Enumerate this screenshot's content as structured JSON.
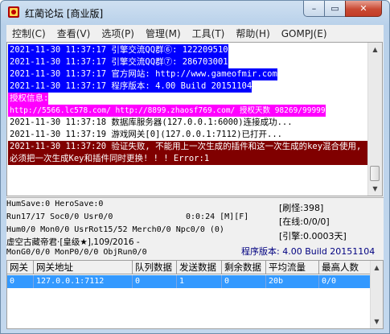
{
  "window": {
    "title": "红蔺论坛 [商业版]",
    "min_glyph": "–",
    "max_glyph": "▭",
    "close_glyph": "✕"
  },
  "menu": [
    "控制(C)",
    "查看(V)",
    "选项(P)",
    "管理(M)",
    "工具(T)",
    "帮助(H)",
    "GOMPJ(E)"
  ],
  "log": [
    {
      "style": "blue",
      "text": "2021-11-30 11:37:17 引擎交流QQ群⑥: 122209510"
    },
    {
      "style": "blue",
      "text": "2021-11-30 11:37:17 引擎交流QQ群⑦: 286703001"
    },
    {
      "style": "blue",
      "text": "2021-11-30 11:37:17 官方网站: http://www.gameofmir.com"
    },
    {
      "style": "blue",
      "text": "2021-11-30 11:37:17 程序版本: 4.00 Build 20151104"
    },
    {
      "style": "mag",
      "text": "授权信息:"
    },
    {
      "style": "mag2",
      "text": "http://5566.lc578.com/ http://8899.zhaosf769.com/ 授权天数 98269/99999"
    },
    {
      "style": "plain",
      "text": "2021-11-30 11:37:18 数据库服务器(127.0.0.1:6000)连接成功..."
    },
    {
      "style": "plain",
      "text": "2021-11-30 11:37:19 游戏网关[0](127.0.0.1:7112)已打开..."
    },
    {
      "style": "red",
      "text": "2021-11-30 11:37:20 验证失败, 不能用上一次生成的插件和这一次生成的key混合使用, 必须把一次生成Key和插件同时更换! ! !  Error:1"
    }
  ],
  "status": {
    "line1": "HumSave:0 HeroSave:0",
    "line2_left": "Run17/17 Soc0/0 Usr0/0",
    "time": "0:0:24 [M][F]",
    "line3": "Hum0/0 Mon0/0 UsrRot15/52 Merch0/0 Npc0/0 (0)",
    "line4": "虚空古藏帝君·[皇级★],109/2016 -",
    "line5": "MonG0/0/0 MonP0/0/0 ObjRun0/0",
    "refresh": "[刷怪:398]",
    "online": "[在线:0/0/0]",
    "engine": "[引擎:0.0003天]",
    "version": "程序版本: 4.00 Build 20151104"
  },
  "gateway_table": {
    "columns": [
      "网关",
      "网关地址",
      "队列数据",
      "发送数据",
      "剩余数据",
      "平均流量",
      "最高人数"
    ],
    "rows": [
      [
        "0",
        "127.0.0.1:7112",
        "0",
        "1",
        "0",
        "20b",
        "0/0"
      ]
    ]
  },
  "colors": {
    "log_blue": "#0000ff",
    "log_magenta": "#ff00ff",
    "log_red": "#800000",
    "selected_row": "#3399ff",
    "version_text": "#000080"
  }
}
